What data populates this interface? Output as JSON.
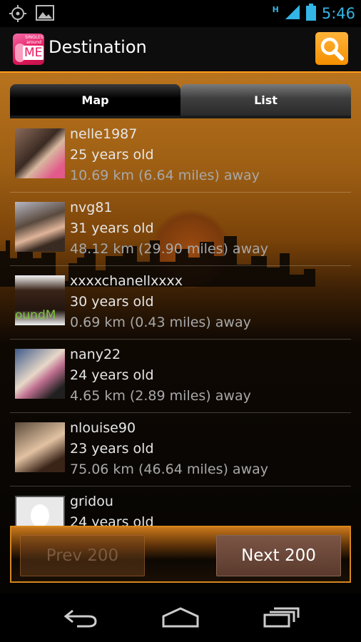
{
  "status_bar": {
    "time": "5:46",
    "network": "H",
    "icons": [
      "gps-icon",
      "image-notification-icon",
      "signal-icon",
      "battery-icon"
    ]
  },
  "action_bar": {
    "title": "Destination",
    "app_icon": {
      "top_text": "SINGLES around",
      "main_text": "ME"
    },
    "search_icon": "magnifier-icon"
  },
  "tabs": [
    {
      "label": "Map",
      "selected": true
    },
    {
      "label": "List",
      "selected": false
    }
  ],
  "users": [
    {
      "name": "nelle1987",
      "age": "25 years old",
      "distance": "10.69 km (6.64 miles) away"
    },
    {
      "name": "nvg81",
      "age": "31 years old",
      "distance": "48.12 km (29.90 miles) away"
    },
    {
      "name": "xxxxchanellxxxx",
      "age": "30 years old",
      "distance": "0.69 km (0.43 miles) away",
      "avatar_text": "oundM"
    },
    {
      "name": "nany22",
      "age": "24 years old",
      "distance": "4.65 km (2.89 miles) away"
    },
    {
      "name": "nlouise90",
      "age": "23 years old",
      "distance": "75.06 km (46.64 miles) away"
    },
    {
      "name": "gridou",
      "age": "24 years old",
      "distance": ""
    }
  ],
  "pagination": {
    "prev_label": "Prev 200",
    "next_label": "Next 200",
    "prev_enabled": false
  },
  "nav_bar": {
    "icons": [
      "back-icon",
      "home-icon",
      "recent-apps-icon"
    ]
  },
  "colors": {
    "accent": "#ff9c1a",
    "status_blue": "#33b5e5",
    "button_text_disabled": "#7b5a3e"
  }
}
